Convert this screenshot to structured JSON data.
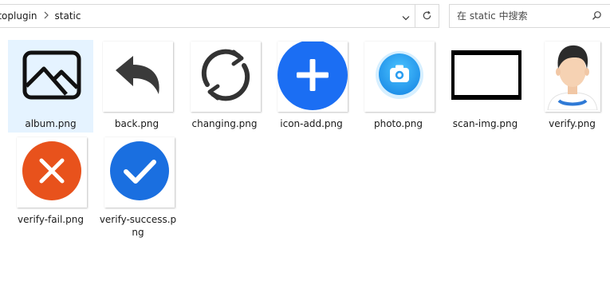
{
  "address_bar": {
    "breadcrumbs": [
      "otoplugin",
      "static"
    ],
    "separator_icon": "chevron-right-icon",
    "dropdown_icon": "chevron-down-icon",
    "refresh_icon": "refresh-icon"
  },
  "search": {
    "placeholder": "在 static 中搜索",
    "icon": "search-icon"
  },
  "files": [
    {
      "name": "album.png",
      "icon": "image-icon",
      "selected": true
    },
    {
      "name": "back.png",
      "icon": "back-arrow-icon",
      "selected": false
    },
    {
      "name": "changing.png",
      "icon": "refresh-circle-icon",
      "selected": false
    },
    {
      "name": "icon-add.png",
      "icon": "plus-circle-icon",
      "selected": false
    },
    {
      "name": "photo.png",
      "icon": "camera-icon",
      "selected": false
    },
    {
      "name": "scan-img.png",
      "icon": "scan-frame-icon",
      "selected": false
    },
    {
      "name": "verify.png",
      "icon": "avatar-icon",
      "selected": false
    },
    {
      "name": "verify-fail.png",
      "icon": "fail-icon",
      "selected": false
    },
    {
      "name": "verify-success.png",
      "icon": "success-icon",
      "selected": false
    }
  ],
  "colors": {
    "selection": "#e5f3ff",
    "add_blue": "#1b6ef3",
    "photo_blue": "#2fa8f5",
    "fail_orange": "#e8521c",
    "success_blue": "#1a6fe0"
  }
}
